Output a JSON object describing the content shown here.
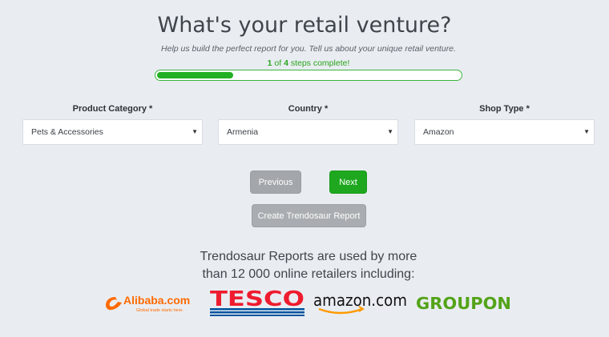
{
  "header": {
    "title": "What's your retail venture?",
    "subtitle": "Help us build the perfect report for you. Tell us about your unique retail venture.",
    "steps_current": "1",
    "steps_of": "of",
    "steps_total": "4",
    "steps_suffix": "steps complete!"
  },
  "progress": {
    "fraction": 0.25,
    "color": "#22b022"
  },
  "fields": {
    "category": {
      "label": "Product Category *",
      "value": "Pets & Accessories"
    },
    "country": {
      "label": "Country *",
      "value": "Armenia"
    },
    "shop_type": {
      "label": "Shop Type *",
      "value": "Amazon"
    }
  },
  "buttons": {
    "previous": "Previous",
    "next": "Next",
    "create": "Create Trendosaur Report"
  },
  "tagline": {
    "line1": "Trendosaur Reports are used by more",
    "line2": "than 12 000 online retailers including:"
  },
  "logos": {
    "alibaba": {
      "name": "Alibaba.com",
      "tagline": "Global trade starts here.",
      "icon": "alibaba-logo"
    },
    "tesco": {
      "name": "TESCO",
      "icon": "tesco-logo"
    },
    "amazon": {
      "name": "amazon.com",
      "icon": "amazon-logo"
    },
    "groupon": {
      "name": "GROUPON",
      "icon": "groupon-logo"
    }
  },
  "colors": {
    "accent_green": "#1fa81f",
    "button_grey": "#a3a7ab",
    "background": "#e9edf2"
  }
}
